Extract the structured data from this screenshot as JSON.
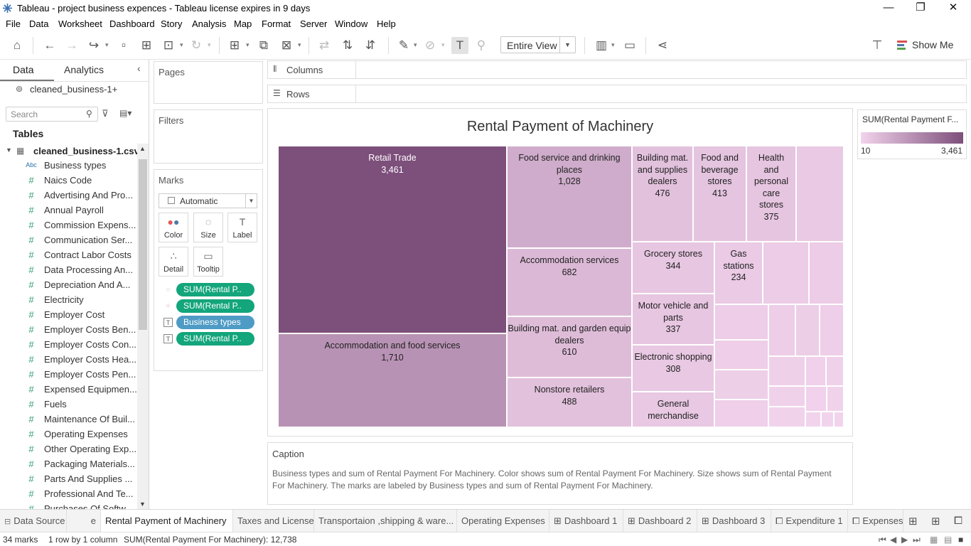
{
  "window": {
    "title": "Tableau - project business expences - Tableau license expires in 9 days",
    "minimize": "—",
    "restore": "❐",
    "close": "✕"
  },
  "menu": [
    "File",
    "Data",
    "Worksheet",
    "Dashboard",
    "Story",
    "Analysis",
    "Map",
    "Format",
    "Server",
    "Window",
    "Help"
  ],
  "toolbar": {
    "fit": "Entire View",
    "show_me": "Show Me"
  },
  "left": {
    "tab_data": "Data",
    "tab_analytics": "Analytics",
    "datasource": "cleaned_business-1+",
    "search_placeholder": "Search",
    "tables_heading": "Tables",
    "table_name": "cleaned_business-1.csv",
    "fields": [
      {
        "icon": "Abc",
        "label": "Business types"
      },
      {
        "icon": "#",
        "label": "Naics Code"
      },
      {
        "icon": "#",
        "label": "Advertising And Pro..."
      },
      {
        "icon": "#",
        "label": "Annual Payroll"
      },
      {
        "icon": "#",
        "label": "Commission Expens..."
      },
      {
        "icon": "#",
        "label": "Communication Ser..."
      },
      {
        "icon": "#",
        "label": "Contract Labor Costs"
      },
      {
        "icon": "#",
        "label": "Data Processing An..."
      },
      {
        "icon": "#",
        "label": "Depreciation And A..."
      },
      {
        "icon": "#",
        "label": "Electricity"
      },
      {
        "icon": "#",
        "label": "Employer Cost"
      },
      {
        "icon": "#",
        "label": "Employer Costs Ben..."
      },
      {
        "icon": "#",
        "label": "Employer Costs Con..."
      },
      {
        "icon": "#",
        "label": "Employer Costs Hea..."
      },
      {
        "icon": "#",
        "label": "Employer Costs Pen..."
      },
      {
        "icon": "#",
        "label": "Expensed Equipmen..."
      },
      {
        "icon": "#",
        "label": "Fuels"
      },
      {
        "icon": "#",
        "label": "Maintenance Of Buil..."
      },
      {
        "icon": "#",
        "label": "Operating Expenses"
      },
      {
        "icon": "#",
        "label": "Other Operating Exp..."
      },
      {
        "icon": "#",
        "label": "Packaging Materials..."
      },
      {
        "icon": "#",
        "label": "Parts And Supplies ..."
      },
      {
        "icon": "#",
        "label": "Professional And Te..."
      },
      {
        "icon": "#",
        "label": "Purchases Of Softw..."
      }
    ]
  },
  "cards": {
    "pages": "Pages",
    "filters": "Filters",
    "marks": "Marks",
    "mark_type": "Automatic",
    "columns": "Columns",
    "rows": "Rows"
  },
  "marks_buttons": [
    {
      "icon": "●●",
      "label": "Color"
    },
    {
      "icon": "◌",
      "label": "Size"
    },
    {
      "icon": "T",
      "label": "Label"
    },
    {
      "icon": "∴",
      "label": "Detail"
    },
    {
      "icon": "▭",
      "label": "Tooltip"
    }
  ],
  "pills": [
    {
      "icon": "◌",
      "label": "SUM(Rental P..",
      "color": "#13a57b"
    },
    {
      "icon": "●",
      "label": "SUM(Rental P..",
      "color": "#13a57b"
    },
    {
      "icon": "T",
      "label": "Business types",
      "color": "#4e9bc5"
    },
    {
      "icon": "T",
      "label": "SUM(Rental P..",
      "color": "#13a57b"
    }
  ],
  "legend": {
    "title": "SUM(Rental Payment F...",
    "min": "10",
    "max": "3,461",
    "color_low": "#f2d3ec",
    "color_high": "#7d4f7b"
  },
  "caption": {
    "title": "Caption",
    "text": "Business types and sum of Rental Payment For Machinery.  Color shows sum of Rental Payment For Machinery.  Size shows sum of Rental Payment For Machinery.  The marks are labeled by Business types and sum of Rental Payment For Machinery."
  },
  "sheet_tabs": [
    "Data Source",
    "e",
    "Rental Payment of Machinery",
    "Taxes and License",
    "Transportaion ,shipping & ware...",
    "Operating Expenses",
    "Dashboard 1",
    "Dashboard 2",
    "Dashboard 3",
    "Expenditure 1",
    "Expenses"
  ],
  "status": {
    "marks": "34 marks",
    "rows": "1 row by 1 column",
    "sum": "SUM(Rental Payment For Machinery): 12,738"
  },
  "chart_data": {
    "type": "treemap",
    "title": "Rental Payment of Machinery",
    "color_min": 10,
    "color_max": 3461,
    "mark_count": 34,
    "total": 12738,
    "items": [
      {
        "name": "Retail Trade",
        "value": 3461
      },
      {
        "name": "Accommodation and food services",
        "value": 1710
      },
      {
        "name": "Food service and drinking places",
        "value": 1028
      },
      {
        "name": "Accommodation services",
        "value": 682
      },
      {
        "name": "Building mat. and garden equip dealers",
        "value": 610
      },
      {
        "name": "Nonstore retailers",
        "value": 488
      },
      {
        "name": "Building mat. and supplies dealers",
        "value": 476
      },
      {
        "name": "Food and beverage stores",
        "value": 413
      },
      {
        "name": "Health and personal care stores",
        "value": 375
      },
      {
        "name": "Grocery stores",
        "value": 344
      },
      {
        "name": "Motor vehicle and parts",
        "value": 337
      },
      {
        "name": "Electronic shopping",
        "value": 308
      },
      {
        "name": "Gas stations",
        "value": 234
      },
      {
        "name": "General merchandise",
        "value": null
      }
    ]
  }
}
